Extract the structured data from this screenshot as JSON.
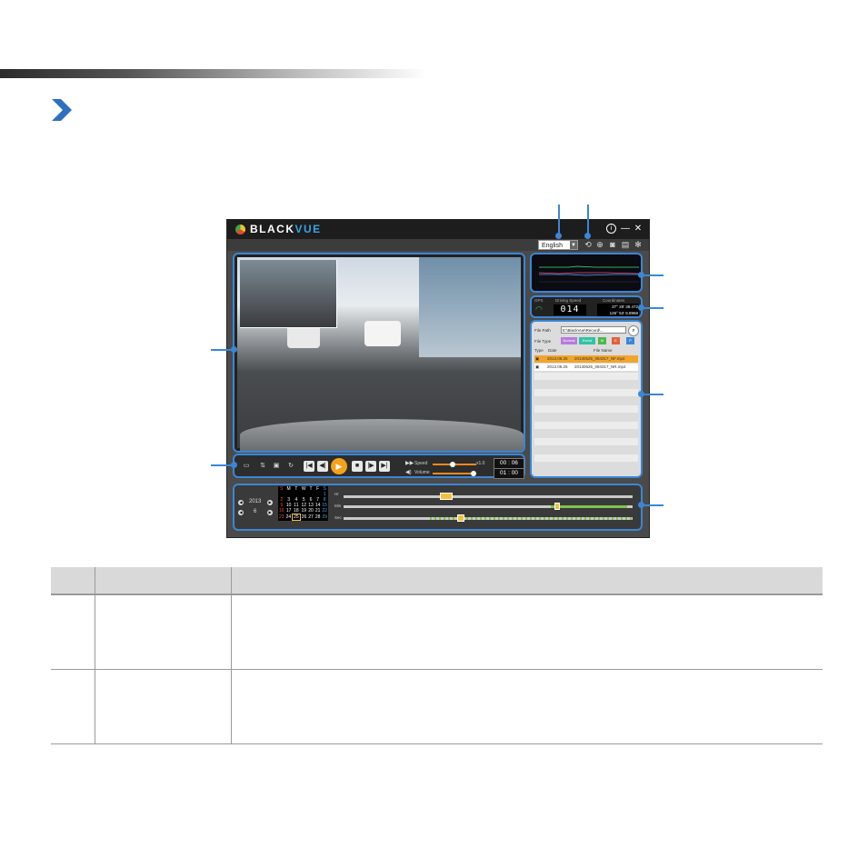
{
  "app": {
    "logo_main": "BLACK",
    "logo_accent": "VUE",
    "language": "English",
    "window_buttons": {
      "info": "i",
      "minimize": "—",
      "close": "✕"
    },
    "toolbar_icons": [
      "repeat-icon",
      "download-icon",
      "camera-icon",
      "print-icon",
      "settings-icon"
    ]
  },
  "speed_panel": {
    "gps_label": "GPS",
    "driving_speed_label": "Driving Speed",
    "speed_value": "014",
    "coordinates_label": "Coordinates",
    "lat": "37° 28' 38.472",
    "lon": "126° 53' 8.8968"
  },
  "file_panel": {
    "path_label": "File Path",
    "path_value": "E:\\BlackVue\\Record\\...",
    "type_label": "File Type",
    "type_buttons": [
      "Normal",
      "Event",
      "M",
      "E",
      "P"
    ],
    "columns": [
      "Type",
      "Date",
      "File Name"
    ],
    "files": [
      {
        "date": "2013.06.25",
        "name": "20130625_084317_NF.mp4"
      },
      {
        "date": "2013.06.25",
        "name": "20130625_084317_NR.mp4"
      }
    ]
  },
  "controls": {
    "speed_label": "Speed",
    "volume_label": "Volume",
    "speed_value": "x1.0",
    "time_current": "00 : 06",
    "time_total": "01 : 00"
  },
  "timeline": {
    "year": "2013",
    "month": "6",
    "weekdays": [
      "S",
      "M",
      "T",
      "W",
      "T",
      "F",
      "S"
    ],
    "weeks": [
      [
        "",
        "",
        "",
        "",
        "",
        "",
        "1"
      ],
      [
        "2",
        "3",
        "4",
        "5",
        "6",
        "7",
        "8"
      ],
      [
        "9",
        "10",
        "11",
        "12",
        "13",
        "14",
        "15"
      ],
      [
        "16",
        "17",
        "18",
        "19",
        "20",
        "21",
        "22"
      ],
      [
        "23",
        "24",
        "25",
        "26",
        "27",
        "28",
        "29"
      ]
    ],
    "row_labels": [
      "Hr",
      "Min",
      "Sec"
    ]
  },
  "table": {
    "rows": 2
  },
  "colors": {
    "accent": "#3b86d6",
    "brand_blue": "#39a3e0",
    "play_orange": "#f3a21b"
  }
}
